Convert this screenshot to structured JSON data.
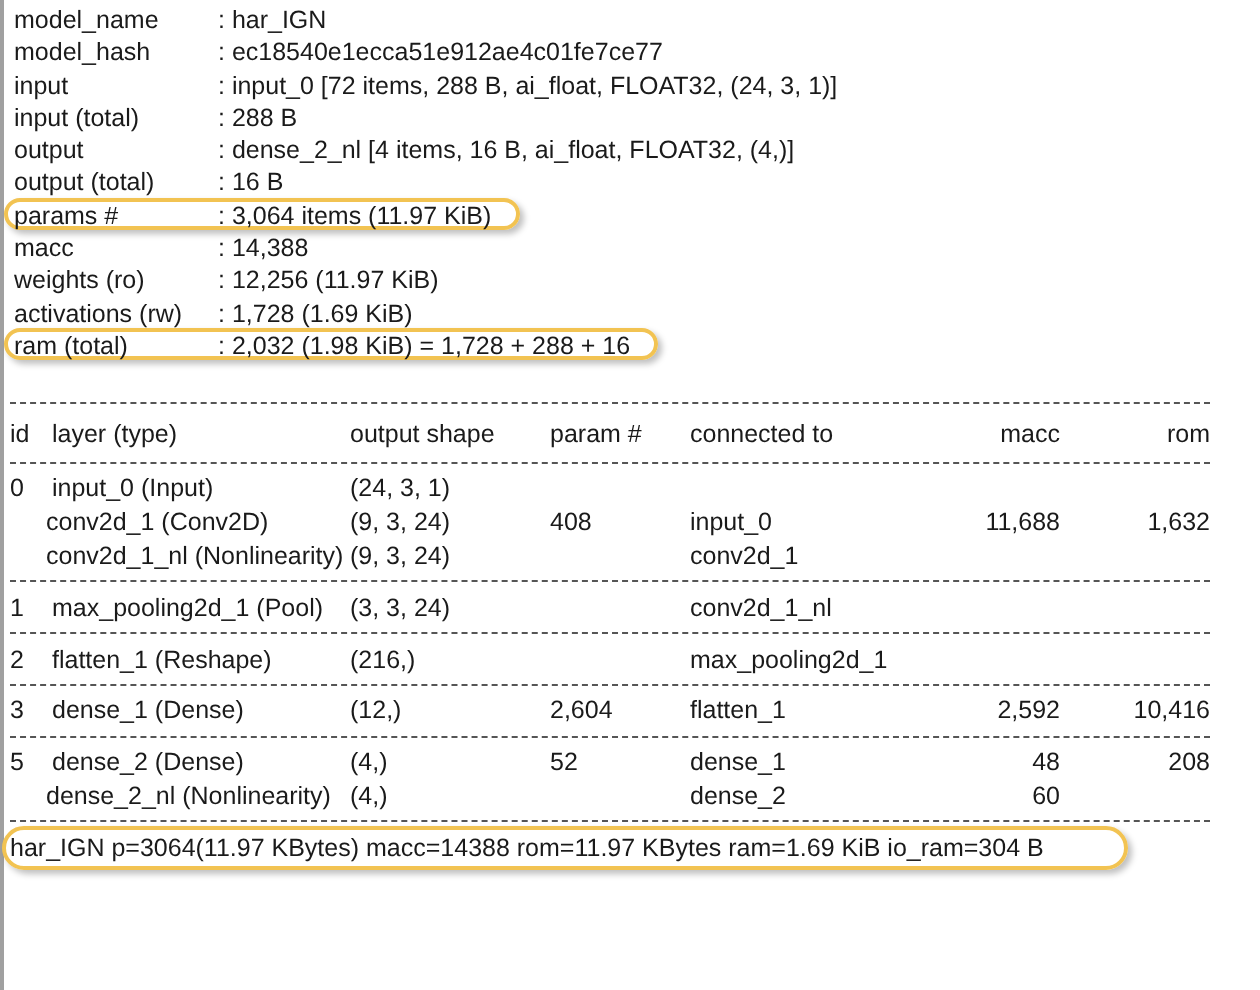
{
  "summary": [
    {
      "key": "model_name",
      "value": ": har_IGN",
      "highlighted": false
    },
    {
      "key": "model_hash",
      "value": ": ec18540e1ecca51e912ae4c01fe7ce77",
      "highlighted": false
    },
    {
      "key": "input",
      "value": ": input_0 [72 items, 288 B, ai_float, FLOAT32, (24, 3, 1)]",
      "highlighted": false
    },
    {
      "key": "input (total)",
      "value": ": 288 B",
      "highlighted": false
    },
    {
      "key": "output",
      "value": ": dense_2_nl [4 items, 16 B, ai_float, FLOAT32, (4,)]",
      "highlighted": false
    },
    {
      "key": "output (total)",
      "value": ": 16 B",
      "highlighted": false
    },
    {
      "key": "params #",
      "value": ": 3,064 items (11.97 KiB)",
      "highlighted": true
    },
    {
      "key": "macc",
      "value": ": 14,388",
      "highlighted": false
    },
    {
      "key": "weights (ro)",
      "value": ": 12,256 (11.97 KiB)",
      "highlighted": false
    },
    {
      "key": "activations (rw)",
      "value": ": 1,728 (1.69 KiB)",
      "highlighted": false
    },
    {
      "key": "ram (total)",
      "value": ": 2,032 (1.98 KiB) = 1,728 + 288 + 16",
      "highlighted": true
    }
  ],
  "table": {
    "columns": [
      "id",
      "layer (type)",
      "output shape",
      "param #",
      "connected to",
      "macc",
      "rom"
    ],
    "groups": [
      {
        "rows": [
          [
            "0",
            "input_0 (Input)",
            "(24, 3, 1)",
            "",
            "",
            "",
            ""
          ],
          [
            "",
            "conv2d_1 (Conv2D)",
            "(9, 3, 24)",
            "408",
            "input_0",
            "11,688",
            "1,632"
          ],
          [
            "",
            "conv2d_1_nl (Nonlinearity)",
            "(9, 3, 24)",
            "",
            "conv2d_1",
            "",
            ""
          ]
        ]
      },
      {
        "rows": [
          [
            "1",
            "max_pooling2d_1 (Pool)",
            "(3, 3, 24)",
            "",
            "conv2d_1_nl",
            "",
            ""
          ]
        ]
      },
      {
        "rows": [
          [
            "2",
            "flatten_1 (Reshape)",
            "(216,)",
            "",
            "max_pooling2d_1",
            "",
            ""
          ]
        ]
      },
      {
        "rows": [
          [
            "3",
            "dense_1 (Dense)",
            "(12,)",
            "2,604",
            "flatten_1",
            "2,592",
            "10,416"
          ]
        ]
      },
      {
        "rows": [
          [
            "5",
            "dense_2 (Dense)",
            "(4,)",
            "52",
            "dense_1",
            "48",
            "208"
          ],
          [
            "",
            "dense_2_nl (Nonlinearity)",
            "(4,)",
            "",
            "dense_2",
            "60",
            ""
          ]
        ]
      }
    ]
  },
  "footer": {
    "text": "har_IGN p=3064(11.97 KBytes) macc=14388 rom=11.97 KBytes ram=1.69 KiB io_ram=304 B",
    "highlighted": true
  }
}
